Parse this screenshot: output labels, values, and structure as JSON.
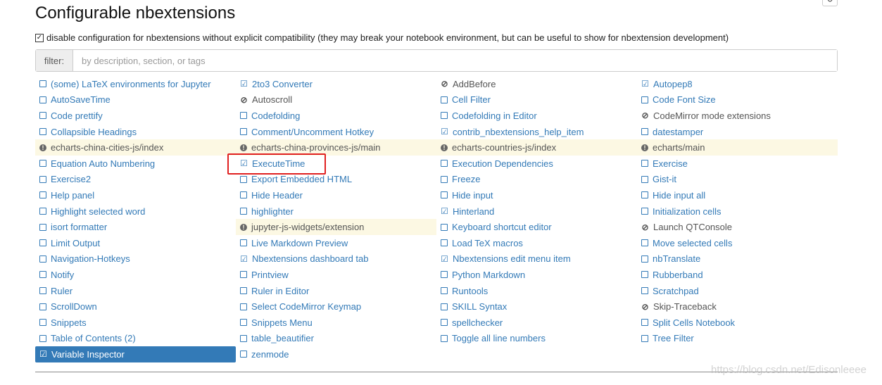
{
  "title": "Configurable nbextensions",
  "compat_label": "disable configuration for nbextensions without explicit compatibility (they may break your notebook environment, but can be useful to show for nbextension development)",
  "compat_checked": true,
  "filter": {
    "label": "filter:",
    "placeholder": "by description, section, or tags",
    "value": ""
  },
  "watermark": "https://blog.csdn.net/Edisonleeee",
  "items": [
    {
      "label": "(some) LaTeX environments for Jupyter",
      "state": "unchecked"
    },
    {
      "label": "2to3 Converter",
      "state": "checked"
    },
    {
      "label": "AddBefore",
      "state": "disabled"
    },
    {
      "label": "Autopep8",
      "state": "checked"
    },
    {
      "label": "AutoSaveTime",
      "state": "unchecked"
    },
    {
      "label": "Autoscroll",
      "state": "disabled"
    },
    {
      "label": "Cell Filter",
      "state": "unchecked"
    },
    {
      "label": "Code Font Size",
      "state": "unchecked"
    },
    {
      "label": "Code prettify",
      "state": "unchecked"
    },
    {
      "label": "Codefolding",
      "state": "unchecked"
    },
    {
      "label": "Codefolding in Editor",
      "state": "unchecked"
    },
    {
      "label": "CodeMirror mode extensions",
      "state": "disabled"
    },
    {
      "label": "Collapsible Headings",
      "state": "unchecked"
    },
    {
      "label": "Comment/Uncomment Hotkey",
      "state": "unchecked"
    },
    {
      "label": "contrib_nbextensions_help_item",
      "state": "checked"
    },
    {
      "label": "datestamper",
      "state": "unchecked"
    },
    {
      "label": "echarts-china-cities-js/index",
      "state": "warning"
    },
    {
      "label": "echarts-china-provinces-js/main",
      "state": "warning"
    },
    {
      "label": "echarts-countries-js/index",
      "state": "warning"
    },
    {
      "label": "echarts/main",
      "state": "warning"
    },
    {
      "label": "Equation Auto Numbering",
      "state": "unchecked"
    },
    {
      "label": "ExecuteTime",
      "state": "checked",
      "highlighted": true
    },
    {
      "label": "Execution Dependencies",
      "state": "unchecked"
    },
    {
      "label": "Exercise",
      "state": "unchecked"
    },
    {
      "label": "Exercise2",
      "state": "unchecked"
    },
    {
      "label": "Export Embedded HTML",
      "state": "unchecked"
    },
    {
      "label": "Freeze",
      "state": "unchecked"
    },
    {
      "label": "Gist-it",
      "state": "unchecked"
    },
    {
      "label": "Help panel",
      "state": "unchecked"
    },
    {
      "label": "Hide Header",
      "state": "unchecked"
    },
    {
      "label": "Hide input",
      "state": "unchecked"
    },
    {
      "label": "Hide input all",
      "state": "unchecked"
    },
    {
      "label": "Highlight selected word",
      "state": "unchecked"
    },
    {
      "label": "highlighter",
      "state": "unchecked"
    },
    {
      "label": "Hinterland",
      "state": "checked"
    },
    {
      "label": "Initialization cells",
      "state": "unchecked"
    },
    {
      "label": "isort formatter",
      "state": "unchecked"
    },
    {
      "label": "jupyter-js-widgets/extension",
      "state": "warning"
    },
    {
      "label": "Keyboard shortcut editor",
      "state": "unchecked"
    },
    {
      "label": "Launch QTConsole",
      "state": "disabled"
    },
    {
      "label": "Limit Output",
      "state": "unchecked"
    },
    {
      "label": "Live Markdown Preview",
      "state": "unchecked"
    },
    {
      "label": "Load TeX macros",
      "state": "unchecked"
    },
    {
      "label": "Move selected cells",
      "state": "unchecked"
    },
    {
      "label": "Navigation-Hotkeys",
      "state": "unchecked"
    },
    {
      "label": "Nbextensions dashboard tab",
      "state": "checked"
    },
    {
      "label": "Nbextensions edit menu item",
      "state": "checked"
    },
    {
      "label": "nbTranslate",
      "state": "unchecked"
    },
    {
      "label": "Notify",
      "state": "unchecked"
    },
    {
      "label": "Printview",
      "state": "unchecked"
    },
    {
      "label": "Python Markdown",
      "state": "unchecked"
    },
    {
      "label": "Rubberband",
      "state": "unchecked"
    },
    {
      "label": "Ruler",
      "state": "unchecked"
    },
    {
      "label": "Ruler in Editor",
      "state": "unchecked"
    },
    {
      "label": "Runtools",
      "state": "unchecked"
    },
    {
      "label": "Scratchpad",
      "state": "unchecked"
    },
    {
      "label": "ScrollDown",
      "state": "unchecked"
    },
    {
      "label": "Select CodeMirror Keymap",
      "state": "unchecked"
    },
    {
      "label": "SKILL Syntax",
      "state": "unchecked"
    },
    {
      "label": "Skip-Traceback",
      "state": "disabled"
    },
    {
      "label": "Snippets",
      "state": "unchecked"
    },
    {
      "label": "Snippets Menu",
      "state": "unchecked"
    },
    {
      "label": "spellchecker",
      "state": "unchecked"
    },
    {
      "label": "Split Cells Notebook",
      "state": "unchecked"
    },
    {
      "label": "Table of Contents (2)",
      "state": "unchecked"
    },
    {
      "label": "table_beautifier",
      "state": "unchecked"
    },
    {
      "label": "Toggle all line numbers",
      "state": "unchecked"
    },
    {
      "label": "Tree Filter",
      "state": "unchecked"
    },
    {
      "label": "Variable Inspector",
      "state": "checked",
      "selected": true
    },
    {
      "label": "zenmode",
      "state": "unchecked"
    }
  ]
}
